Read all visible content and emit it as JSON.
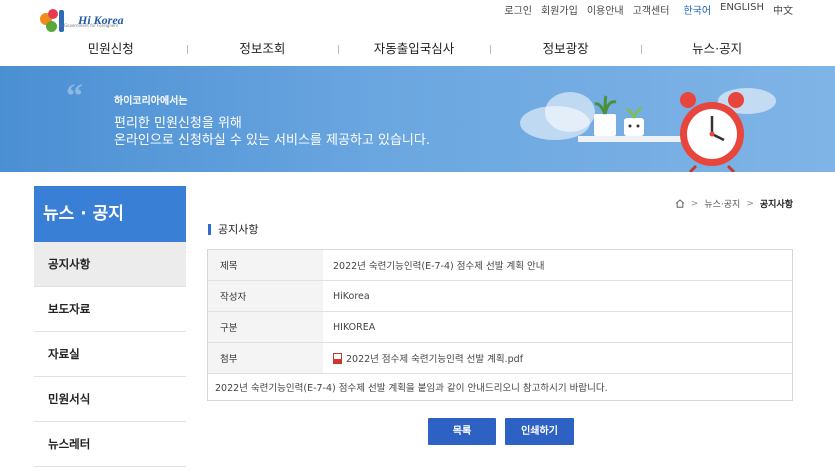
{
  "header": {
    "logo_text": "Hi Korea",
    "logo_sub": "e-Government for Foreigners",
    "util_links": [
      "로그인",
      "회원가입",
      "이용안내",
      "고객센터"
    ],
    "languages": [
      "한국어",
      "ENGLISH",
      "中文"
    ]
  },
  "gnb": [
    "민원신청",
    "정보조회",
    "자동출입국심사",
    "정보광장",
    "뉴스·공지"
  ],
  "banner": {
    "sub": "하이코리아에서는",
    "line1": "편리한 민원신청을 위해",
    "line2": "온라인으로 신청하실 수 있는 서비스를 제공하고 있습니다."
  },
  "lnb": {
    "title": "뉴스 · 공지",
    "items": [
      "공지사항",
      "보도자료",
      "자료실",
      "민원서식",
      "뉴스레터"
    ]
  },
  "breadcrumb": {
    "items": [
      "뉴스·공지",
      "공지사항"
    ]
  },
  "section_title": "공지사항",
  "board": {
    "rows": [
      {
        "th": "제목",
        "td": "2022년 숙련기능인력(E-7-4) 점수제 선발 계획 안내"
      },
      {
        "th": "작성자",
        "td": "HiKorea"
      },
      {
        "th": "구분",
        "td": "HIKOREA"
      },
      {
        "th": "첨부",
        "td": "2022년 점수제 숙련기능인력 선발 계획.pdf"
      }
    ],
    "body": "2022년 숙련기능인력(E-7-4) 점수제 선발 계획을 붙임과 같이 안내드리오니 참고하시기 바랍니다."
  },
  "buttons": {
    "list": "목록",
    "print": "인쇄하기"
  },
  "colors": {
    "accent": "#2e61c4",
    "lnb_title_bg": "#3a7fd6",
    "banner": "#5a9bdb"
  }
}
